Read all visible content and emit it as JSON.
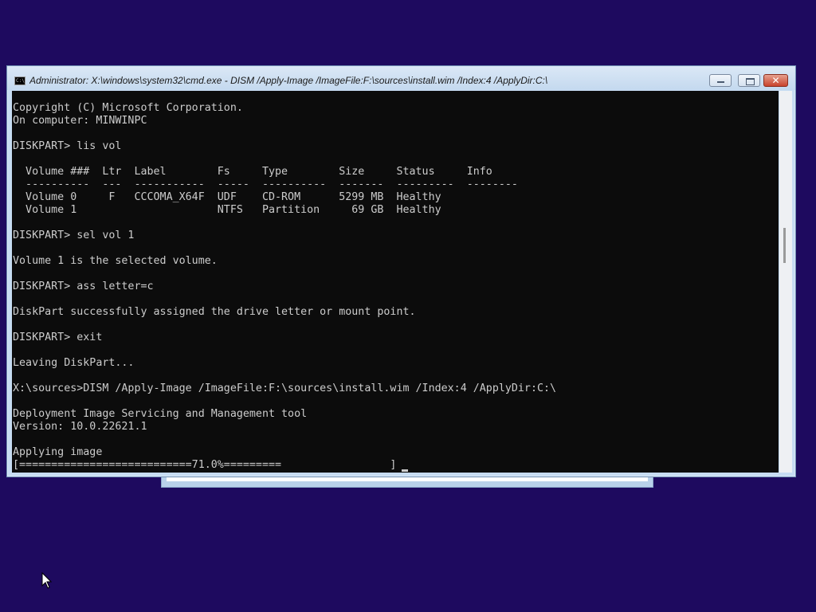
{
  "window": {
    "title": "Administrator: X:\\windows\\system32\\cmd.exe - DISM  /Apply-Image /ImageFile:F:\\sources\\install.wim /Index:4 /ApplyDir:C:\\",
    "icon": "cmd-icon",
    "buttons": {
      "minimize": "minimize",
      "maximize": "maximize",
      "close": "✕"
    }
  },
  "console": {
    "lines": [
      "Copyright (C) Microsoft Corporation.",
      "On computer: MINWINPC",
      "",
      "DISKPART> lis vol",
      "",
      "  Volume ###  Ltr  Label        Fs     Type        Size     Status     Info",
      "  ----------  ---  -----------  -----  ----------  -------  ---------  --------",
      "  Volume 0     F   CCCOMA_X64F  UDF    CD-ROM      5299 MB  Healthy",
      "  Volume 1                      NTFS   Partition     69 GB  Healthy",
      "",
      "DISKPART> sel vol 1",
      "",
      "Volume 1 is the selected volume.",
      "",
      "DISKPART> ass letter=c",
      "",
      "DiskPart successfully assigned the drive letter or mount point.",
      "",
      "DISKPART> exit",
      "",
      "Leaving DiskPart...",
      "",
      "X:\\sources>DISM /Apply-Image /ImageFile:F:\\sources\\install.wim /Index:4 /ApplyDir:C:\\",
      "",
      "Deployment Image Servicing and Management tool",
      "Version: 10.0.22621.1",
      "",
      "Applying image",
      "[===========================71.0%=========                 ]"
    ],
    "progress_percent": 71.0,
    "colors": {
      "background": "#0c0c0c",
      "text": "#cccccc"
    }
  },
  "desktop": {
    "background": "#1e0a5f"
  }
}
